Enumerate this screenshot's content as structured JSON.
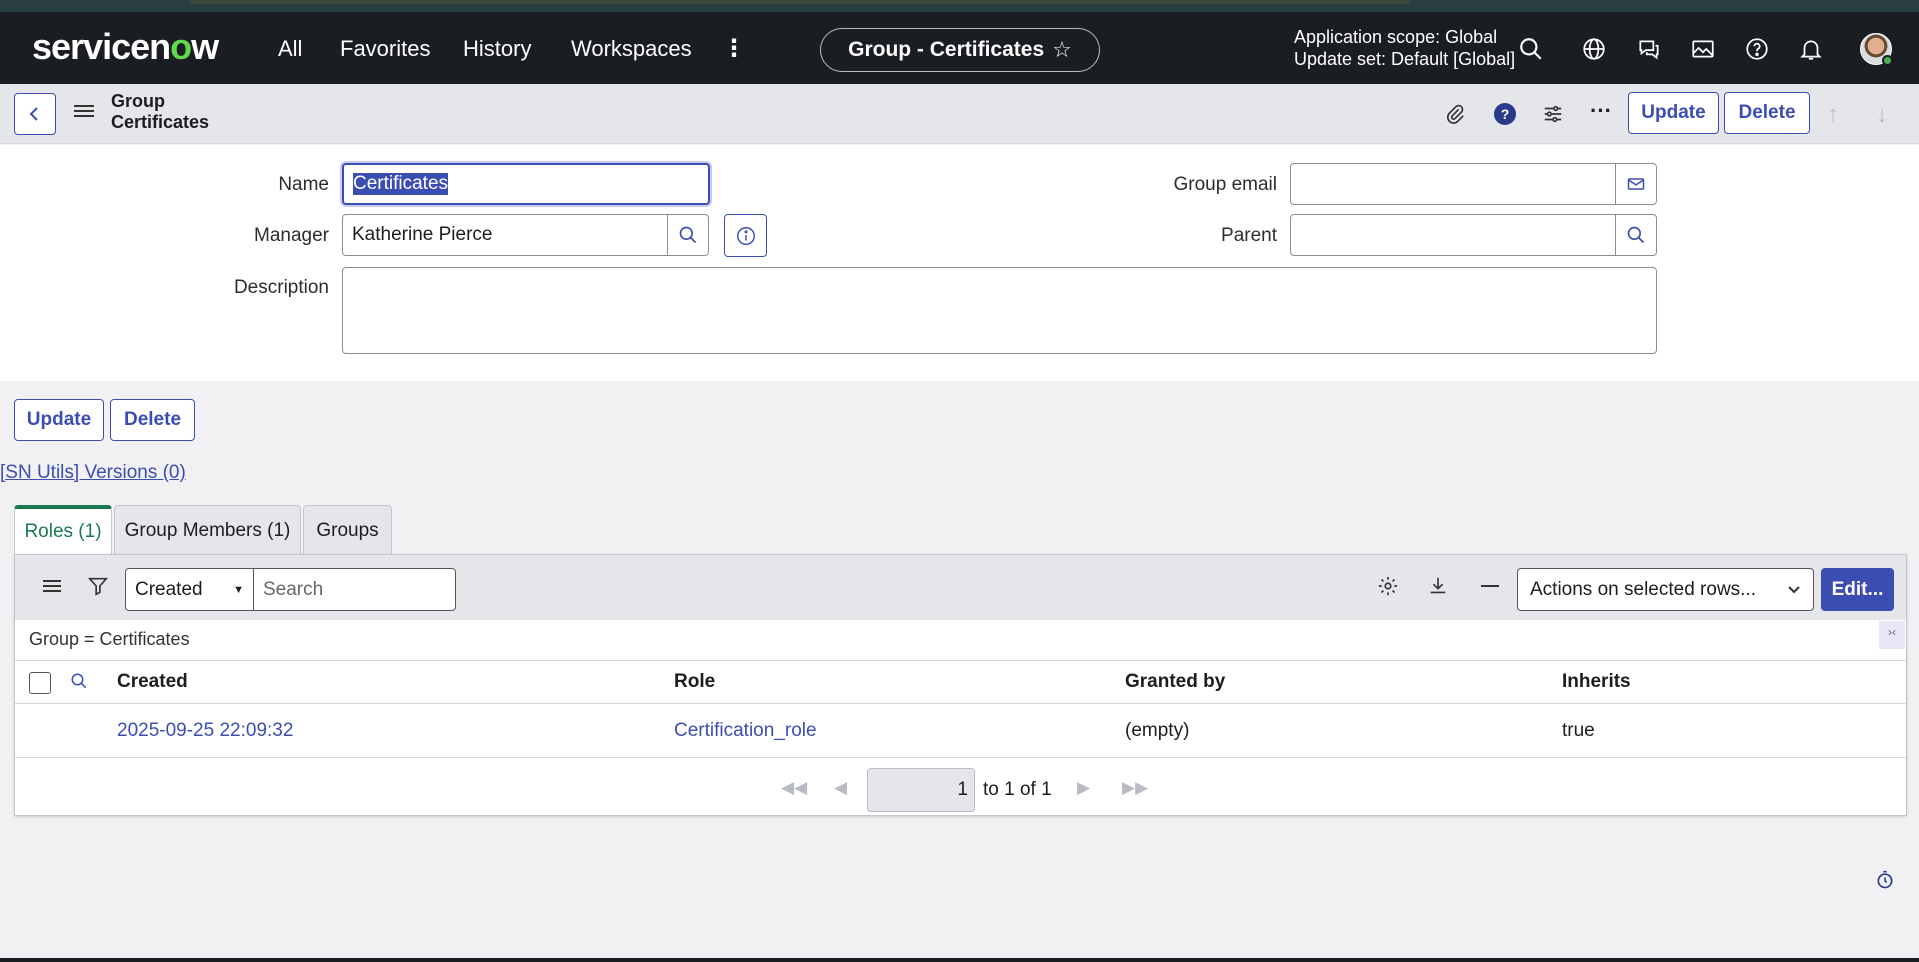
{
  "nav": {
    "logo_text": "servicen",
    "logo_o": "o",
    "logo_end": "w",
    "links": [
      "All",
      "Favorites",
      "History",
      "Workspaces"
    ],
    "record_title": "Group - Certificates",
    "scope_line1": "Application scope: Global",
    "scope_line2": "Update set: Default [Global]",
    "icons": [
      "search-icon",
      "globe-icon",
      "chat-icon",
      "picture-icon",
      "help-icon",
      "bell-icon"
    ]
  },
  "header": {
    "crumb_line1": "Group",
    "crumb_line2": "Certificates",
    "update_label": "Update",
    "delete_label": "Delete"
  },
  "form": {
    "name_label": "Name",
    "name_value": "Certificates",
    "manager_label": "Manager",
    "manager_value": "Katherine Pierce",
    "description_label": "Description",
    "group_email_label": "Group email",
    "parent_label": "Parent",
    "update_label": "Update",
    "delete_label": "Delete"
  },
  "sn_utils_link": "[SN Utils] Versions (0)",
  "tabs": [
    {
      "label": "Roles (1)",
      "active": true
    },
    {
      "label": "Group Members (1)",
      "active": false
    },
    {
      "label": "Groups",
      "active": false
    }
  ],
  "list": {
    "search_field": "Created",
    "search_placeholder": "Search",
    "actions_label": "Actions on selected rows...",
    "edit_label": "Edit...",
    "filter_text": "Group = Certificates",
    "columns": [
      "Created",
      "Role",
      "Granted by",
      "Inherits"
    ],
    "rows": [
      {
        "created": "2025-09-25 22:09:32",
        "role": "Certification_role",
        "granted_by": "(empty)",
        "inherits": "true"
      }
    ],
    "page_value": "1",
    "page_text": "to 1 of 1"
  },
  "colors": {
    "accent": "#3c4db2",
    "active_tab": "#1a7a4f",
    "navbar": "#1a1d21"
  }
}
